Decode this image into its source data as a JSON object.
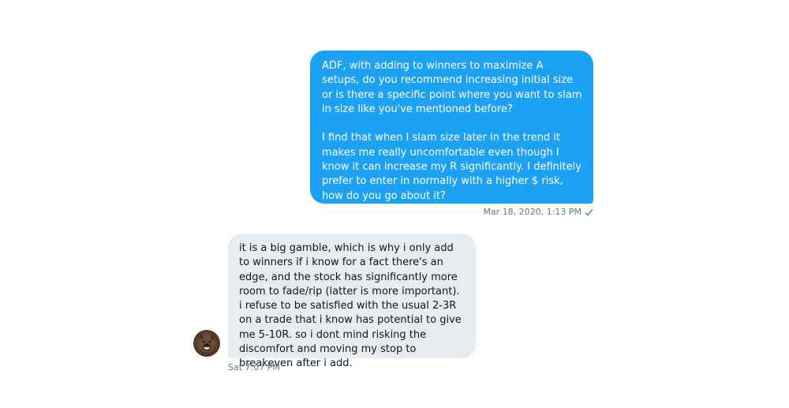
{
  "conversation": {
    "sent_message": {
      "text": "ADF, with adding to winners to maximize A setups, do you recommend increasing initial size or is there a specific point where you want to slam in size like you've mentioned before?\n\nI find that when I slam size later in the trend it makes me really uncomfortable even though I know it can increase my R significantly. I definitely prefer to enter in normally with a higher $ risk, how do you go about it?",
      "timestamp": "Mar 18, 2020, 1:13 PM",
      "status_icon": "checkmark-icon"
    },
    "received_message": {
      "text": "it is a big gamble, which is why i only add to winners if i know for a fact there's an edge, and the stock has significantly more room to fade/rip (latter is more important). i refuse to be satisfied with the usual 2-3R on a trade that i know has potential to give me 5-10R. so i dont mind risking the discomfort and moving my stop to breakeven after i add.",
      "timestamp": "Sat 7:07 PM",
      "avatar_icon": "bear-avatar-icon"
    }
  },
  "colors": {
    "sent_bubble": "#1da1f2",
    "received_bubble": "#e6ecf0",
    "meta_text": "#657786"
  }
}
